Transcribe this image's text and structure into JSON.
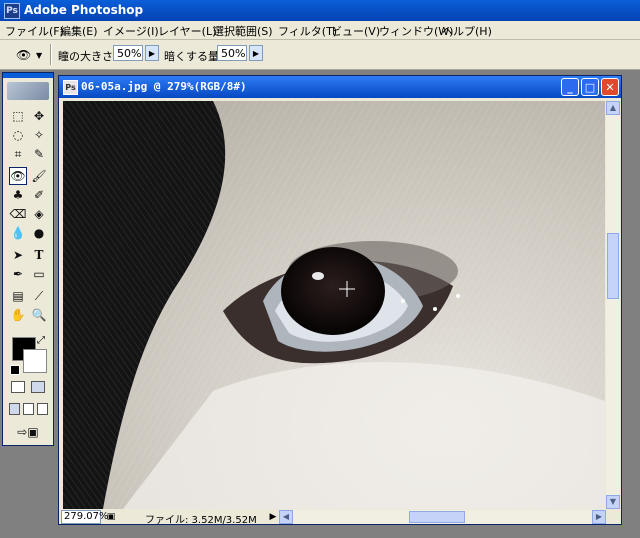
{
  "app": {
    "title": "Adobe Photoshop",
    "icon": "photoshop-app-icon"
  },
  "menu": [
    {
      "label": "ファイル(F)"
    },
    {
      "label": "編集(E)"
    },
    {
      "label": "イメージ(I)"
    },
    {
      "label": "レイヤー(L)"
    },
    {
      "label": "選択範囲(S)"
    },
    {
      "label": "フィルタ(T)"
    },
    {
      "label": "ビュー(V)"
    },
    {
      "label": "ウィンドウ(W)"
    },
    {
      "label": "ヘルプ(H)"
    }
  ],
  "options": {
    "pupil_size_label": "瞳の大きさ:",
    "pupil_size_value": "50%",
    "darken_label": "暗くする量:",
    "darken_value": "50%"
  },
  "document": {
    "title": "06-05a.jpg @ 279%(RGB/8#)",
    "zoom": "279.07%",
    "file_info": "ファイル: 3.52M/3.52M"
  },
  "colors": {
    "titlebar": "#0548c2",
    "foreground": "#000000",
    "background": "#ffffff"
  }
}
